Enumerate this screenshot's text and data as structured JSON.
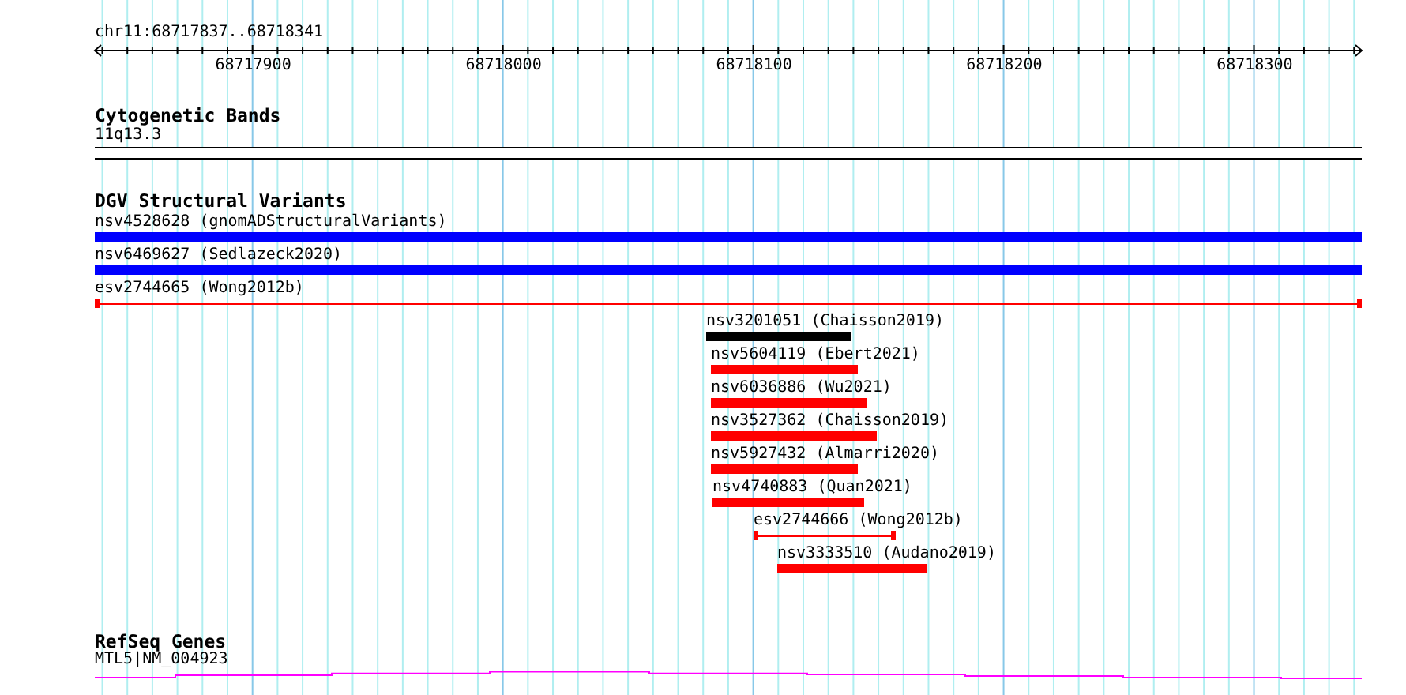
{
  "ruler": {
    "region": "chr11:68717837..68718341",
    "ticks": [
      "68717900",
      "68718000",
      "68718100",
      "68718200",
      "68718300"
    ]
  },
  "tracks": [
    {
      "title": "Cytogenetic Bands",
      "kind": "bands",
      "features": [
        {
          "label": "11q13.3"
        }
      ]
    },
    {
      "title": "DGV Structural Variants",
      "kind": "variants",
      "features": [
        {
          "label": "nsv4528628 (gnomADStructuralVariants)",
          "kind": "bar",
          "color": "#0000ff"
        },
        {
          "label": "nsv6469627 (Sedlazeck2020)",
          "kind": "bar",
          "color": "#0000ff"
        },
        {
          "label": "esv2744665 (Wong2012b)",
          "kind": "span",
          "color": "#ff0000"
        },
        {
          "label": "nsv3201051 (Chaisson2019)",
          "kind": "bar",
          "color": "#000000"
        },
        {
          "label": "nsv5604119 (Ebert2021)",
          "kind": "bar",
          "color": "#ff0000"
        },
        {
          "label": "nsv6036886 (Wu2021)",
          "kind": "bar",
          "color": "#ff0000"
        },
        {
          "label": "nsv3527362 (Chaisson2019)",
          "kind": "bar",
          "color": "#ff0000"
        },
        {
          "label": "nsv5927432 (Almarri2020)",
          "kind": "bar",
          "color": "#ff0000"
        },
        {
          "label": "nsv4740883 (Quan2021)",
          "kind": "bar",
          "color": "#ff0000"
        },
        {
          "label": "esv2744666 (Wong2012b)",
          "kind": "span",
          "color": "#ff0000"
        },
        {
          "label": "nsv3333510 (Audano2019)",
          "kind": "bar",
          "color": "#ff0000"
        }
      ]
    },
    {
      "title": "RefSeq Genes",
      "kind": "genes",
      "features": [
        {
          "label": "MTL5|NM_004923"
        }
      ]
    }
  ]
}
